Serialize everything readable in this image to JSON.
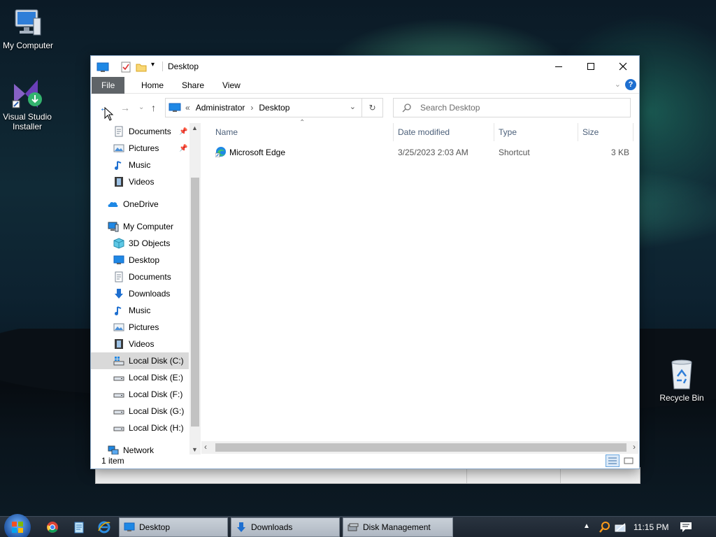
{
  "desktop": {
    "icons": [
      {
        "label": "My Computer",
        "icon": "computer-icon"
      },
      {
        "label": "Visual Studio Installer",
        "icon": "visual-studio-installer-icon"
      },
      {
        "label": "Recycle Bin",
        "icon": "recycle-bin-icon"
      }
    ]
  },
  "window": {
    "title": "Desktop",
    "ribbon_tabs": [
      "File",
      "Home",
      "Share",
      "View"
    ],
    "address": {
      "root": "Administrator",
      "current": "Desktop"
    },
    "search_placeholder": "Search Desktop",
    "nav": {
      "quick_access": [
        {
          "label": "Documents",
          "icon": "documents-icon",
          "pinned": true
        },
        {
          "label": "Pictures",
          "icon": "pictures-icon",
          "pinned": true
        },
        {
          "label": "Music",
          "icon": "music-icon"
        },
        {
          "label": "Videos",
          "icon": "videos-icon"
        }
      ],
      "onedrive": "OneDrive",
      "my_computer": "My Computer",
      "my_computer_children": [
        {
          "label": "3D Objects",
          "icon": "3d-objects-icon"
        },
        {
          "label": "Desktop",
          "icon": "desktop-folder-icon"
        },
        {
          "label": "Documents",
          "icon": "documents-icon"
        },
        {
          "label": "Downloads",
          "icon": "downloads-icon"
        },
        {
          "label": "Music",
          "icon": "music-icon"
        },
        {
          "label": "Pictures",
          "icon": "pictures-icon"
        },
        {
          "label": "Videos",
          "icon": "videos-icon"
        },
        {
          "label": "Local Disk (C:)",
          "icon": "system-drive-icon",
          "selected": true
        },
        {
          "label": "Local Disk (E:)",
          "icon": "drive-icon"
        },
        {
          "label": "Local Disk (F:)",
          "icon": "drive-icon"
        },
        {
          "label": "Local Disk (G:)",
          "icon": "drive-icon"
        },
        {
          "label": "Local Dick (H:)",
          "icon": "drive-icon"
        }
      ],
      "network": "Network"
    },
    "columns": [
      "Name",
      "Date modified",
      "Type",
      "Size"
    ],
    "files": [
      {
        "name": "Microsoft Edge",
        "date": "3/25/2023 2:03 AM",
        "type": "Shortcut",
        "size": "3 KB",
        "icon": "edge-icon"
      }
    ],
    "status": "1 item"
  },
  "taskbar": {
    "buttons": [
      {
        "label": "Desktop",
        "icon": "desktop-folder-icon"
      },
      {
        "label": "Downloads",
        "icon": "downloads-icon"
      },
      {
        "label": "Disk Management",
        "icon": "disk-management-icon"
      }
    ],
    "clock": "11:15 PM"
  }
}
